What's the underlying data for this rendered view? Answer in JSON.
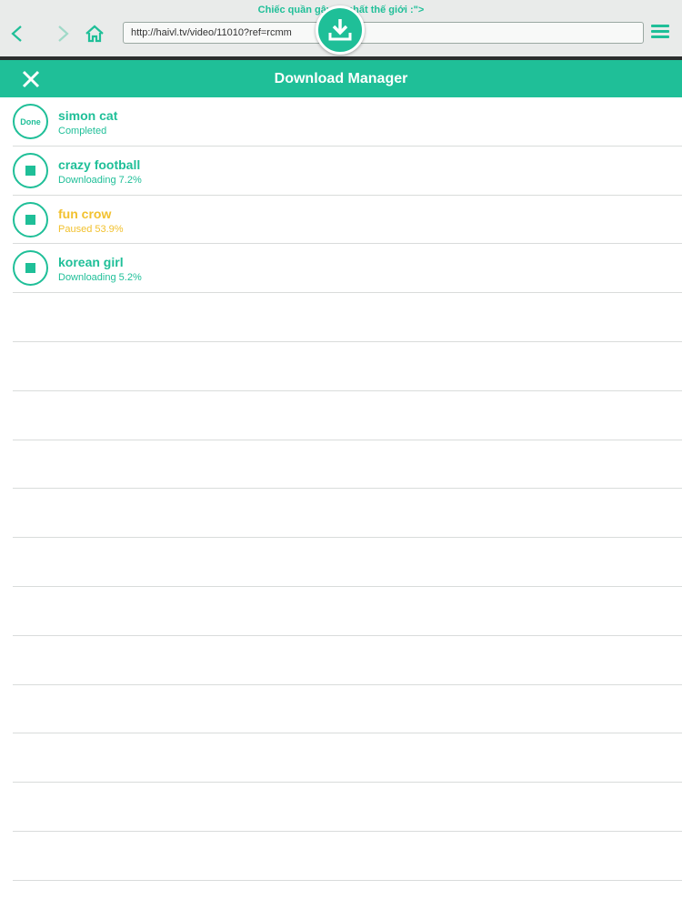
{
  "browser": {
    "page_title": "Chiếc quần gây th nhất thế giới :\">",
    "url": "http://haivl.tv/video/11010?ref=rcmm"
  },
  "panel": {
    "title": "Download Manager"
  },
  "downloads": [
    {
      "name": "simon cat",
      "status": "Completed",
      "badge": "Done",
      "state": "done"
    },
    {
      "name": "crazy football",
      "status": "Downloading 7.2%",
      "state": "downloading",
      "progress": 7.2
    },
    {
      "name": "fun crow",
      "status": "Paused 53.9%",
      "state": "paused",
      "progress": 53.9
    },
    {
      "name": "korean girl",
      "status": "Downloading 5.2%",
      "state": "downloading",
      "progress": 5.2
    }
  ],
  "colors": {
    "accent": "#1fbf98",
    "paused": "#f2c12e",
    "divider": "#d9dcdb"
  },
  "icons": {
    "back": "chevron-left-icon",
    "forward": "chevron-right-icon",
    "home": "home-icon",
    "menu": "hamburger-menu-icon",
    "download": "download-icon",
    "close": "close-icon",
    "stop": "stop-icon"
  }
}
